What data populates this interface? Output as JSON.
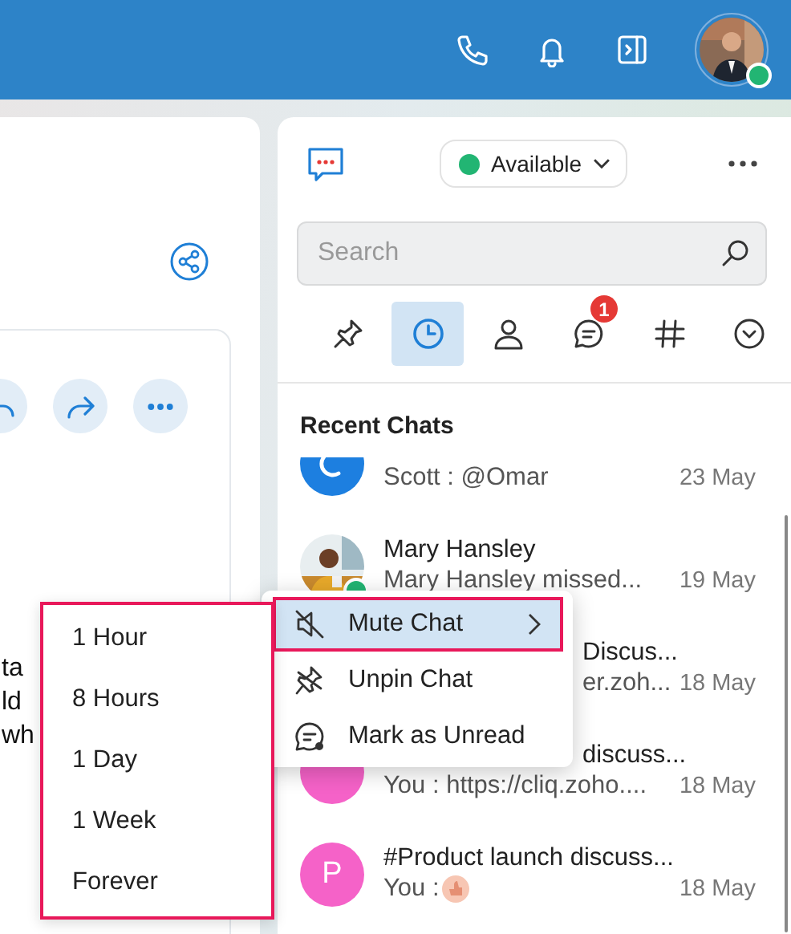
{
  "top_bar": {
    "profile": {
      "online": true
    }
  },
  "left_panel": {
    "text_fragments": [
      "ta",
      "ld",
      "wh"
    ]
  },
  "chat_panel": {
    "status": {
      "label": "Available"
    },
    "search": {
      "placeholder": "Search"
    },
    "tabs": [
      {
        "kind": "pinned",
        "selected": false
      },
      {
        "kind": "recent",
        "selected": true
      },
      {
        "kind": "contacts",
        "selected": false
      },
      {
        "kind": "chats",
        "selected": false,
        "badge": "1"
      },
      {
        "kind": "channels",
        "selected": false
      },
      {
        "kind": "more",
        "selected": false
      }
    ],
    "section_title": "Recent Chats",
    "chats": [
      {
        "kind": "glyph",
        "color": "#1d7fe0",
        "preview": "Scott : @Omar",
        "date": "23 May"
      },
      {
        "online": true,
        "title": "Mary Hansley",
        "preview": "Mary Hansley missed...",
        "date": "19 May"
      },
      {
        "kind": "covered",
        "title": "Discus...",
        "preview": "er.zoh...",
        "date": "18 May"
      },
      {
        "kind": "covered_title",
        "color": "#f562c8",
        "title": "discuss...",
        "preview": "You : https://cliq.zoho....",
        "date": "18 May"
      },
      {
        "kind": "letter",
        "color": "#f562c8",
        "letter": "P",
        "title": "#Product launch discuss...",
        "preview": "You : ",
        "reaction": true,
        "date": "18 May"
      }
    ]
  },
  "context_menu": {
    "items": [
      {
        "kind": "mute",
        "label": "Mute Chat",
        "submenu": true,
        "selected": true
      },
      {
        "kind": "unpin",
        "label": "Unpin Chat",
        "submenu": false,
        "selected": false
      },
      {
        "kind": "unread",
        "label": "Mark as Unread",
        "submenu": false,
        "selected": false
      }
    ]
  },
  "submenu": {
    "items": [
      "1 Hour",
      "8 Hours",
      "1 Day",
      "1 Week",
      "Forever"
    ]
  }
}
